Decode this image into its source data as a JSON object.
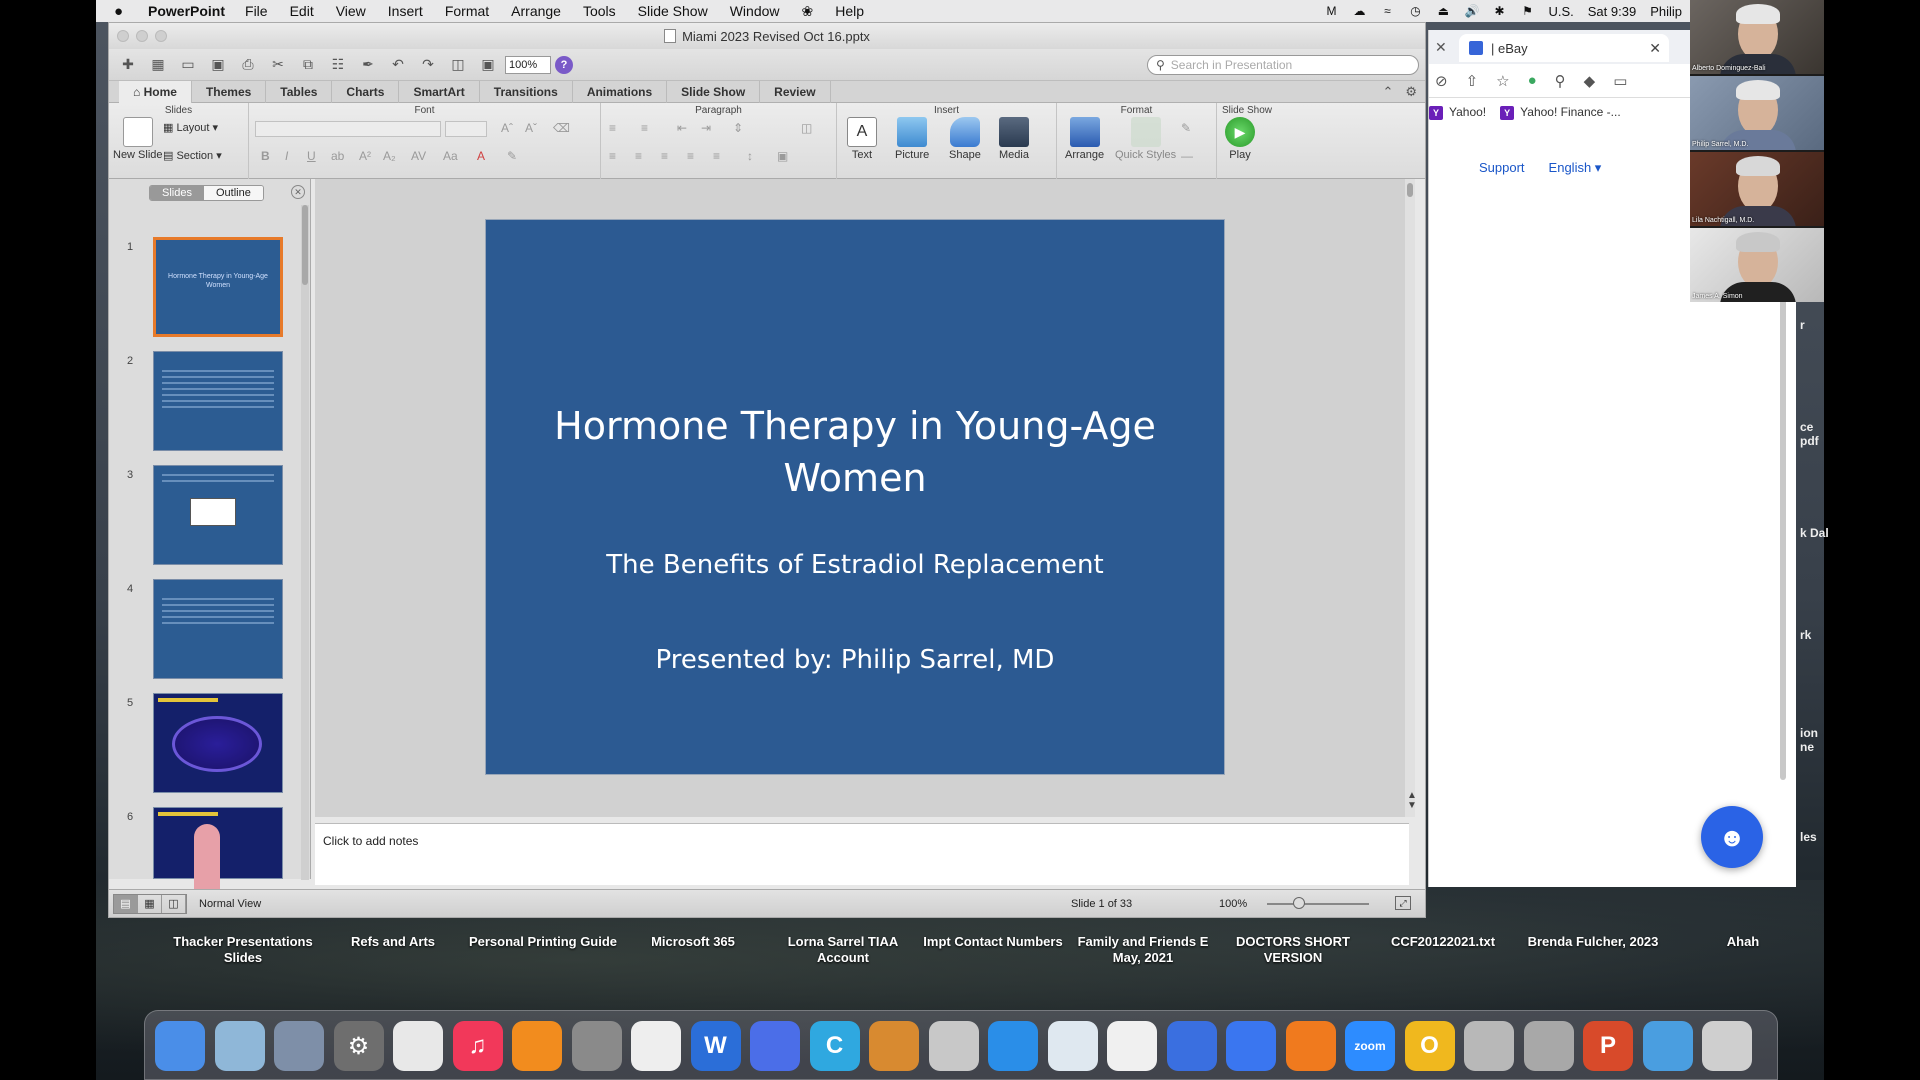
{
  "menubar": {
    "apple": "",
    "app_name": "PowerPoint",
    "items": [
      "File",
      "Edit",
      "View",
      "Insert",
      "Format",
      "Arrange",
      "Tools",
      "Slide Show",
      "Window",
      "Help"
    ],
    "input_source": "U.S.",
    "clock": "Sat 9:39",
    "user": "Philip"
  },
  "ppt": {
    "title": "Miami 2023 Revised Oct 16.pptx",
    "zoom": "100%",
    "search_placeholder": "Search in Presentation",
    "tabs": [
      "Home",
      "Themes",
      "Tables",
      "Charts",
      "SmartArt",
      "Transitions",
      "Animations",
      "Slide Show",
      "Review"
    ],
    "groups": {
      "slides": "Slides",
      "font": "Font",
      "paragraph": "Paragraph",
      "insert": "Insert",
      "format": "Format",
      "slideshow": "Slide Show"
    },
    "buttons": {
      "new_slide": "New Slide",
      "layout": "Layout",
      "section": "Section",
      "text": "Text",
      "picture": "Picture",
      "shape": "Shape",
      "media": "Media",
      "arrange": "Arrange",
      "quick_styles": "Quick Styles",
      "play": "Play"
    },
    "sidebar": {
      "seg_slides": "Slides",
      "seg_outline": "Outline",
      "thumbs": [
        {
          "num": "1",
          "title": "Hormone Therapy in Young-Age Women"
        },
        {
          "num": "2"
        },
        {
          "num": "3"
        },
        {
          "num": "4"
        },
        {
          "num": "5"
        },
        {
          "num": "6"
        }
      ]
    },
    "slide": {
      "title": "Hormone Therapy in Young-Age Women",
      "subtitle": "The Benefits of Estradiol Replacement",
      "presenter": "Presented by: Philip Sarrel, MD"
    },
    "notes_placeholder": "Click to add notes",
    "status": {
      "view": "Normal View",
      "slide_counter": "Slide 1 of 33",
      "zoom": "100%"
    }
  },
  "browser": {
    "tab_title": "| eBay",
    "bookmarks": [
      "Yahoo!",
      "Yahoo! Finance -..."
    ],
    "links": {
      "support": "Support",
      "language": "English"
    }
  },
  "participants": [
    {
      "name": "Alberto Dominguez-Bali"
    },
    {
      "name": "Philip Sarrel, M.D."
    },
    {
      "name": "Lila Nachtigall, M.D."
    },
    {
      "name": "James A. Simon"
    }
  ],
  "desktop_peek": [
    "r",
    "ce",
    "pdf",
    "k Dal",
    "rk",
    "ion",
    "ne",
    "les"
  ],
  "desktop_icons": [
    "Thacker Presentations Slides",
    "Refs and Arts",
    "Personal Printing Guide",
    "Microsoft 365",
    "Lorna Sarrel TIAA Account",
    "Impt Contact Numbers",
    "Family and Friends E May, 2021",
    "DOCTORS SHORT VERSION",
    "CCF20122021.txt",
    "Brenda Fulcher, 2023",
    "Ahah"
  ],
  "dock_apps": [
    {
      "name": "Finder",
      "color": "#4a8ee8",
      "glyph": ""
    },
    {
      "name": "Preview",
      "color": "#8fb7d8",
      "glyph": ""
    },
    {
      "name": "Image Capture",
      "color": "#7e8fa8",
      "glyph": ""
    },
    {
      "name": "System Preferences",
      "color": "#6e6e6e",
      "glyph": "⚙"
    },
    {
      "name": "Chrome",
      "color": "#e8e8e8",
      "glyph": ""
    },
    {
      "name": "Music",
      "color": "#f2385a",
      "glyph": "♫"
    },
    {
      "name": "Books",
      "color": "#f28c1e",
      "glyph": ""
    },
    {
      "name": "Script Editor",
      "color": "#8a8a8a",
      "glyph": ""
    },
    {
      "name": "TextEdit",
      "color": "#eeeeee",
      "glyph": ""
    },
    {
      "name": "Word",
      "color": "#2b6ed8",
      "glyph": "W"
    },
    {
      "name": "Teams",
      "color": "#4b6ee8",
      "glyph": ""
    },
    {
      "name": "C App",
      "color": "#2fa8e0",
      "glyph": "C"
    },
    {
      "name": "Calculator",
      "color": "#d88a30",
      "glyph": ""
    },
    {
      "name": "Photo App",
      "color": "#c8c8c8",
      "glyph": ""
    },
    {
      "name": "Safari",
      "color": "#2a8ee8",
      "glyph": ""
    },
    {
      "name": "Preview Docs",
      "color": "#dfe8f0",
      "glyph": ""
    },
    {
      "name": "Photos",
      "color": "#f0f0f0",
      "glyph": ""
    },
    {
      "name": "Messenger",
      "color": "#3a6fe0",
      "glyph": ""
    },
    {
      "name": "Signal",
      "color": "#3a76f0",
      "glyph": ""
    },
    {
      "name": "Firefox",
      "color": "#f07a1e",
      "glyph": ""
    },
    {
      "name": "Zoom",
      "color": "#2d8cff",
      "glyph": "zoom"
    },
    {
      "name": "Outlook O",
      "color": "#f0b81e",
      "glyph": "O"
    },
    {
      "name": "Disk Utility",
      "color": "#b8b8b8",
      "glyph": ""
    },
    {
      "name": "Keychain",
      "color": "#a8a8a8",
      "glyph": ""
    },
    {
      "name": "PowerPoint",
      "color": "#d84a2a",
      "glyph": "P"
    },
    {
      "name": "Downloads",
      "color": "#4a9ee0",
      "glyph": ""
    },
    {
      "name": "Trash",
      "color": "#cfcfcf",
      "glyph": ""
    }
  ]
}
